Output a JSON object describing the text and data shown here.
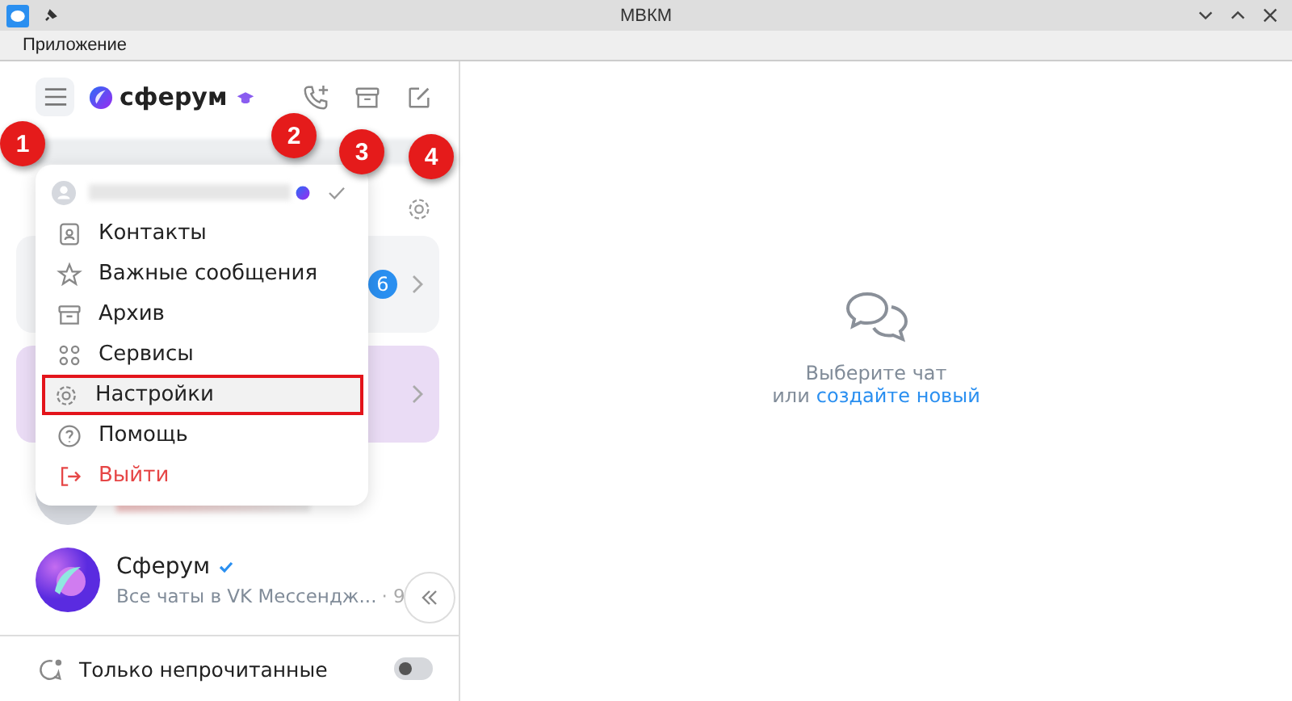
{
  "window": {
    "title": "МВКМ"
  },
  "menubar": [
    "Приложение"
  ],
  "header": {
    "brand": "сферум"
  },
  "chats": [
    {
      "selected": false,
      "badge": "6"
    },
    {
      "selected": true
    },
    {
      "selected": false,
      "kind": "blurred"
    },
    {
      "selected": false,
      "kind": "chat",
      "name": "Сферум",
      "verified": true,
      "preview": "Все чаты в VK Мессендж...",
      "time": "· 9"
    }
  ],
  "menu": [
    {
      "kind": "item",
      "label": "Контакты",
      "highlighted": false
    },
    {
      "kind": "item",
      "label": "Важные сообщения",
      "highlighted": false
    },
    {
      "kind": "item",
      "label": "Архив",
      "highlighted": false
    },
    {
      "kind": "item",
      "label": "Сервисы",
      "highlighted": false
    },
    {
      "kind": "item",
      "label": "Настройки",
      "highlighted": true
    },
    {
      "kind": "item",
      "label": "Помощь",
      "highlighted": false
    },
    {
      "kind": "danger",
      "label": "Выйти",
      "highlighted": false
    }
  ],
  "filter": {
    "label": "Только непрочитанные",
    "on": false
  },
  "empty": {
    "text": "Выберите чат",
    "prefix": "или",
    "link": "создайте новый"
  },
  "callouts": [
    "1",
    "2",
    "3",
    "4"
  ]
}
